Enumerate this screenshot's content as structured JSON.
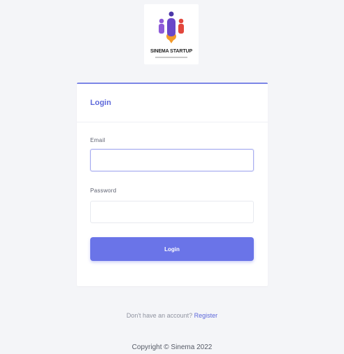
{
  "logo": {
    "title": "SINEMA STARTUP",
    "icon": "startup-rocket-people-icon"
  },
  "login_card": {
    "header": "Login",
    "email_label": "Email",
    "email_value": "",
    "password_label": "Password",
    "password_value": "",
    "submit_label": "Login"
  },
  "footer": {
    "register_prompt": "Don't have an account?",
    "register_link": "Register",
    "copyright": "Copyright © Sinema 2022"
  },
  "colors": {
    "accent": "#6a74e8",
    "background": "#f4f5f8",
    "card": "#ffffff"
  }
}
